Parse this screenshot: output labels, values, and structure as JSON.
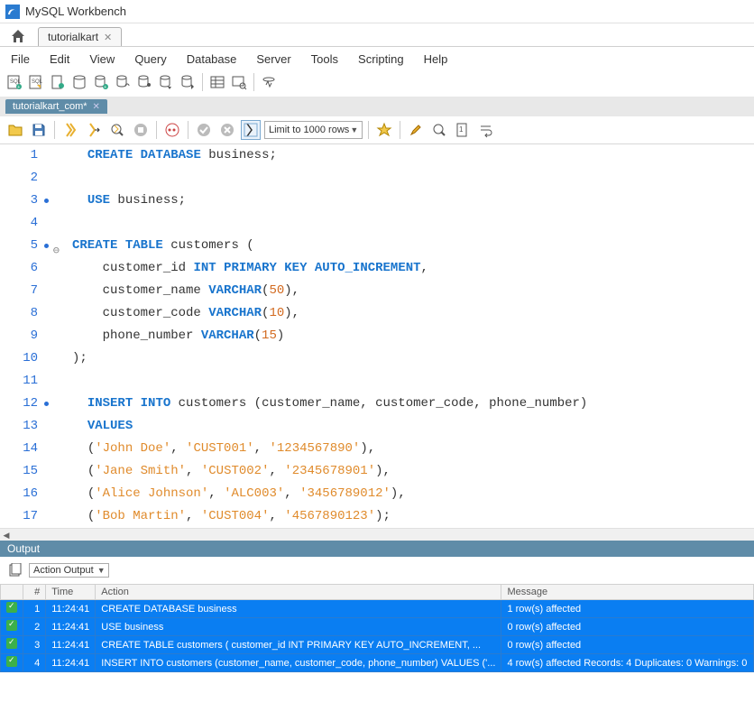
{
  "app": {
    "title": "MySQL Workbench"
  },
  "top_tab": {
    "label": "tutorialkart"
  },
  "menu": [
    "File",
    "Edit",
    "View",
    "Query",
    "Database",
    "Server",
    "Tools",
    "Scripting",
    "Help"
  ],
  "doc_tab": {
    "label": "tutorialkart_com*"
  },
  "limit": {
    "label": "Limit to 1000 rows"
  },
  "code": {
    "lines": [
      {
        "n": 1,
        "dot": false,
        "tokens": [
          {
            "c": "kw",
            "t": "CREATE"
          },
          {
            "c": "pn",
            "t": " "
          },
          {
            "c": "kw",
            "t": "DATABASE"
          },
          {
            "c": "pn",
            "t": " business;"
          }
        ],
        "indent": "  "
      },
      {
        "n": 2,
        "dot": false,
        "tokens": [],
        "indent": ""
      },
      {
        "n": 3,
        "dot": true,
        "tokens": [
          {
            "c": "kw",
            "t": "USE"
          },
          {
            "c": "pn",
            "t": " business;"
          }
        ],
        "indent": "  "
      },
      {
        "n": 4,
        "dot": false,
        "tokens": [],
        "indent": ""
      },
      {
        "n": 5,
        "dot": true,
        "fold": true,
        "tokens": [
          {
            "c": "kw",
            "t": "CREATE"
          },
          {
            "c": "pn",
            "t": " "
          },
          {
            "c": "kw",
            "t": "TABLE"
          },
          {
            "c": "pn",
            "t": " customers ("
          }
        ],
        "indent": ""
      },
      {
        "n": 6,
        "dot": false,
        "tokens": [
          {
            "c": "pn",
            "t": "customer_id "
          },
          {
            "c": "ty",
            "t": "INT"
          },
          {
            "c": "pn",
            "t": " "
          },
          {
            "c": "ty",
            "t": "PRIMARY"
          },
          {
            "c": "pn",
            "t": " "
          },
          {
            "c": "ty",
            "t": "KEY"
          },
          {
            "c": "pn",
            "t": " "
          },
          {
            "c": "ty",
            "t": "AUTO_INCREMENT"
          },
          {
            "c": "pn",
            "t": ","
          }
        ],
        "indent": "    "
      },
      {
        "n": 7,
        "dot": false,
        "tokens": [
          {
            "c": "pn",
            "t": "customer_name "
          },
          {
            "c": "ty",
            "t": "VARCHAR"
          },
          {
            "c": "pn",
            "t": "("
          },
          {
            "c": "num",
            "t": "50"
          },
          {
            "c": "pn",
            "t": "),"
          }
        ],
        "indent": "    "
      },
      {
        "n": 8,
        "dot": false,
        "tokens": [
          {
            "c": "pn",
            "t": "customer_code "
          },
          {
            "c": "ty",
            "t": "VARCHAR"
          },
          {
            "c": "pn",
            "t": "("
          },
          {
            "c": "num",
            "t": "10"
          },
          {
            "c": "pn",
            "t": "),"
          }
        ],
        "indent": "    "
      },
      {
        "n": 9,
        "dot": false,
        "tokens": [
          {
            "c": "pn",
            "t": "phone_number "
          },
          {
            "c": "ty",
            "t": "VARCHAR"
          },
          {
            "c": "pn",
            "t": "("
          },
          {
            "c": "num",
            "t": "15"
          },
          {
            "c": "pn",
            "t": ")"
          }
        ],
        "indent": "    "
      },
      {
        "n": 10,
        "dot": false,
        "tokens": [
          {
            "c": "pn",
            "t": ");"
          }
        ],
        "indent": ""
      },
      {
        "n": 11,
        "dot": false,
        "tokens": [],
        "indent": ""
      },
      {
        "n": 12,
        "dot": true,
        "tokens": [
          {
            "c": "kw",
            "t": "INSERT"
          },
          {
            "c": "pn",
            "t": " "
          },
          {
            "c": "kw",
            "t": "INTO"
          },
          {
            "c": "pn",
            "t": " customers (customer_name, customer_code, phone_number)"
          }
        ],
        "indent": "  "
      },
      {
        "n": 13,
        "dot": false,
        "tokens": [
          {
            "c": "kw",
            "t": "VALUES"
          }
        ],
        "indent": "  "
      },
      {
        "n": 14,
        "dot": false,
        "tokens": [
          {
            "c": "pn",
            "t": "("
          },
          {
            "c": "str",
            "t": "'John Doe'"
          },
          {
            "c": "pn",
            "t": ", "
          },
          {
            "c": "str",
            "t": "'CUST001'"
          },
          {
            "c": "pn",
            "t": ", "
          },
          {
            "c": "str",
            "t": "'1234567890'"
          },
          {
            "c": "pn",
            "t": "),"
          }
        ],
        "indent": "  "
      },
      {
        "n": 15,
        "dot": false,
        "tokens": [
          {
            "c": "pn",
            "t": "("
          },
          {
            "c": "str",
            "t": "'Jane Smith'"
          },
          {
            "c": "pn",
            "t": ", "
          },
          {
            "c": "str",
            "t": "'CUST002'"
          },
          {
            "c": "pn",
            "t": ", "
          },
          {
            "c": "str",
            "t": "'2345678901'"
          },
          {
            "c": "pn",
            "t": "),"
          }
        ],
        "indent": "  "
      },
      {
        "n": 16,
        "dot": false,
        "tokens": [
          {
            "c": "pn",
            "t": "("
          },
          {
            "c": "str",
            "t": "'Alice Johnson'"
          },
          {
            "c": "pn",
            "t": ", "
          },
          {
            "c": "str",
            "t": "'ALC003'"
          },
          {
            "c": "pn",
            "t": ", "
          },
          {
            "c": "str",
            "t": "'3456789012'"
          },
          {
            "c": "pn",
            "t": "),"
          }
        ],
        "indent": "  "
      },
      {
        "n": 17,
        "dot": false,
        "tokens": [
          {
            "c": "pn",
            "t": "("
          },
          {
            "c": "str",
            "t": "'Bob Martin'"
          },
          {
            "c": "pn",
            "t": ", "
          },
          {
            "c": "str",
            "t": "'CUST004'"
          },
          {
            "c": "pn",
            "t": ", "
          },
          {
            "c": "str",
            "t": "'4567890123'"
          },
          {
            "c": "pn",
            "t": ");"
          }
        ],
        "indent": "  "
      }
    ]
  },
  "output": {
    "title": "Output",
    "selector": "Action Output",
    "headers": {
      "hash": "#",
      "time": "Time",
      "action": "Action",
      "message": "Message"
    },
    "rows": [
      {
        "n": "1",
        "time": "11:24:41",
        "action": "CREATE DATABASE business",
        "message": "1 row(s) affected"
      },
      {
        "n": "2",
        "time": "11:24:41",
        "action": "USE business",
        "message": "0 row(s) affected"
      },
      {
        "n": "3",
        "time": "11:24:41",
        "action": "CREATE TABLE customers (     customer_id INT PRIMARY KEY AUTO_INCREMENT, ...",
        "message": "0 row(s) affected"
      },
      {
        "n": "4",
        "time": "11:24:41",
        "action": "INSERT INTO customers (customer_name, customer_code, phone_number) VALUES  ('...",
        "message": "4 row(s) affected Records: 4  Duplicates: 0  Warnings: 0"
      }
    ]
  }
}
